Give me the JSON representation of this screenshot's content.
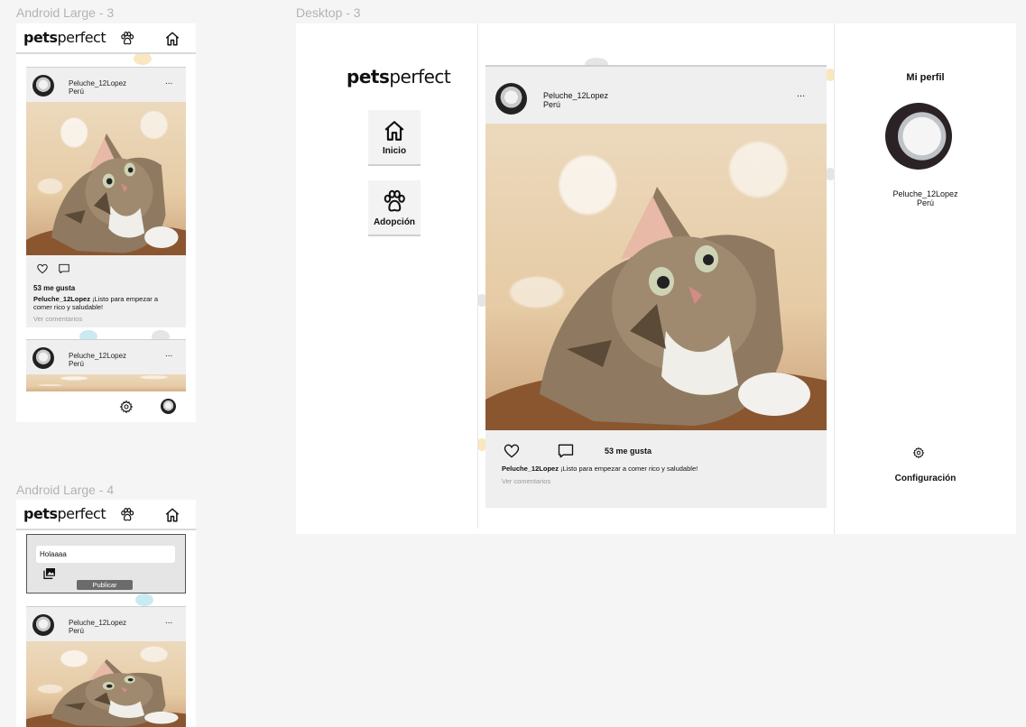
{
  "frames": {
    "android3": "Android Large - 3",
    "android4": "Android Large - 4",
    "desktop3": "Desktop - 3"
  },
  "brand": {
    "bold": "pets",
    "regular": "perfect"
  },
  "post": {
    "username": "Peluche_12Lopez",
    "location": "Perú",
    "more": "...",
    "likes": "53 me gusta",
    "caption": "¡Listo para empezar a comer rico y saludable!",
    "comments_link": "Ver comentarios"
  },
  "composer": {
    "value": "Holaaaa",
    "publish_label": "Publicar"
  },
  "nav": {
    "home_label": "Inicio",
    "adoption_label": "Adopción"
  },
  "profile": {
    "title": "Mi perfil",
    "username": "Peluche_12Lopez",
    "location": "Perú",
    "settings_label": "Configuración"
  },
  "icons": {
    "paw": "paw-icon",
    "home": "home-icon",
    "heart": "heart-icon",
    "comment": "comment-icon",
    "gear": "gear-icon",
    "gallery": "gallery-icon"
  },
  "colors": {
    "canvas": "#f5f5f5",
    "card": "#efefef",
    "publish_button": "#6b6b6b",
    "label": "#b3b3b3"
  }
}
